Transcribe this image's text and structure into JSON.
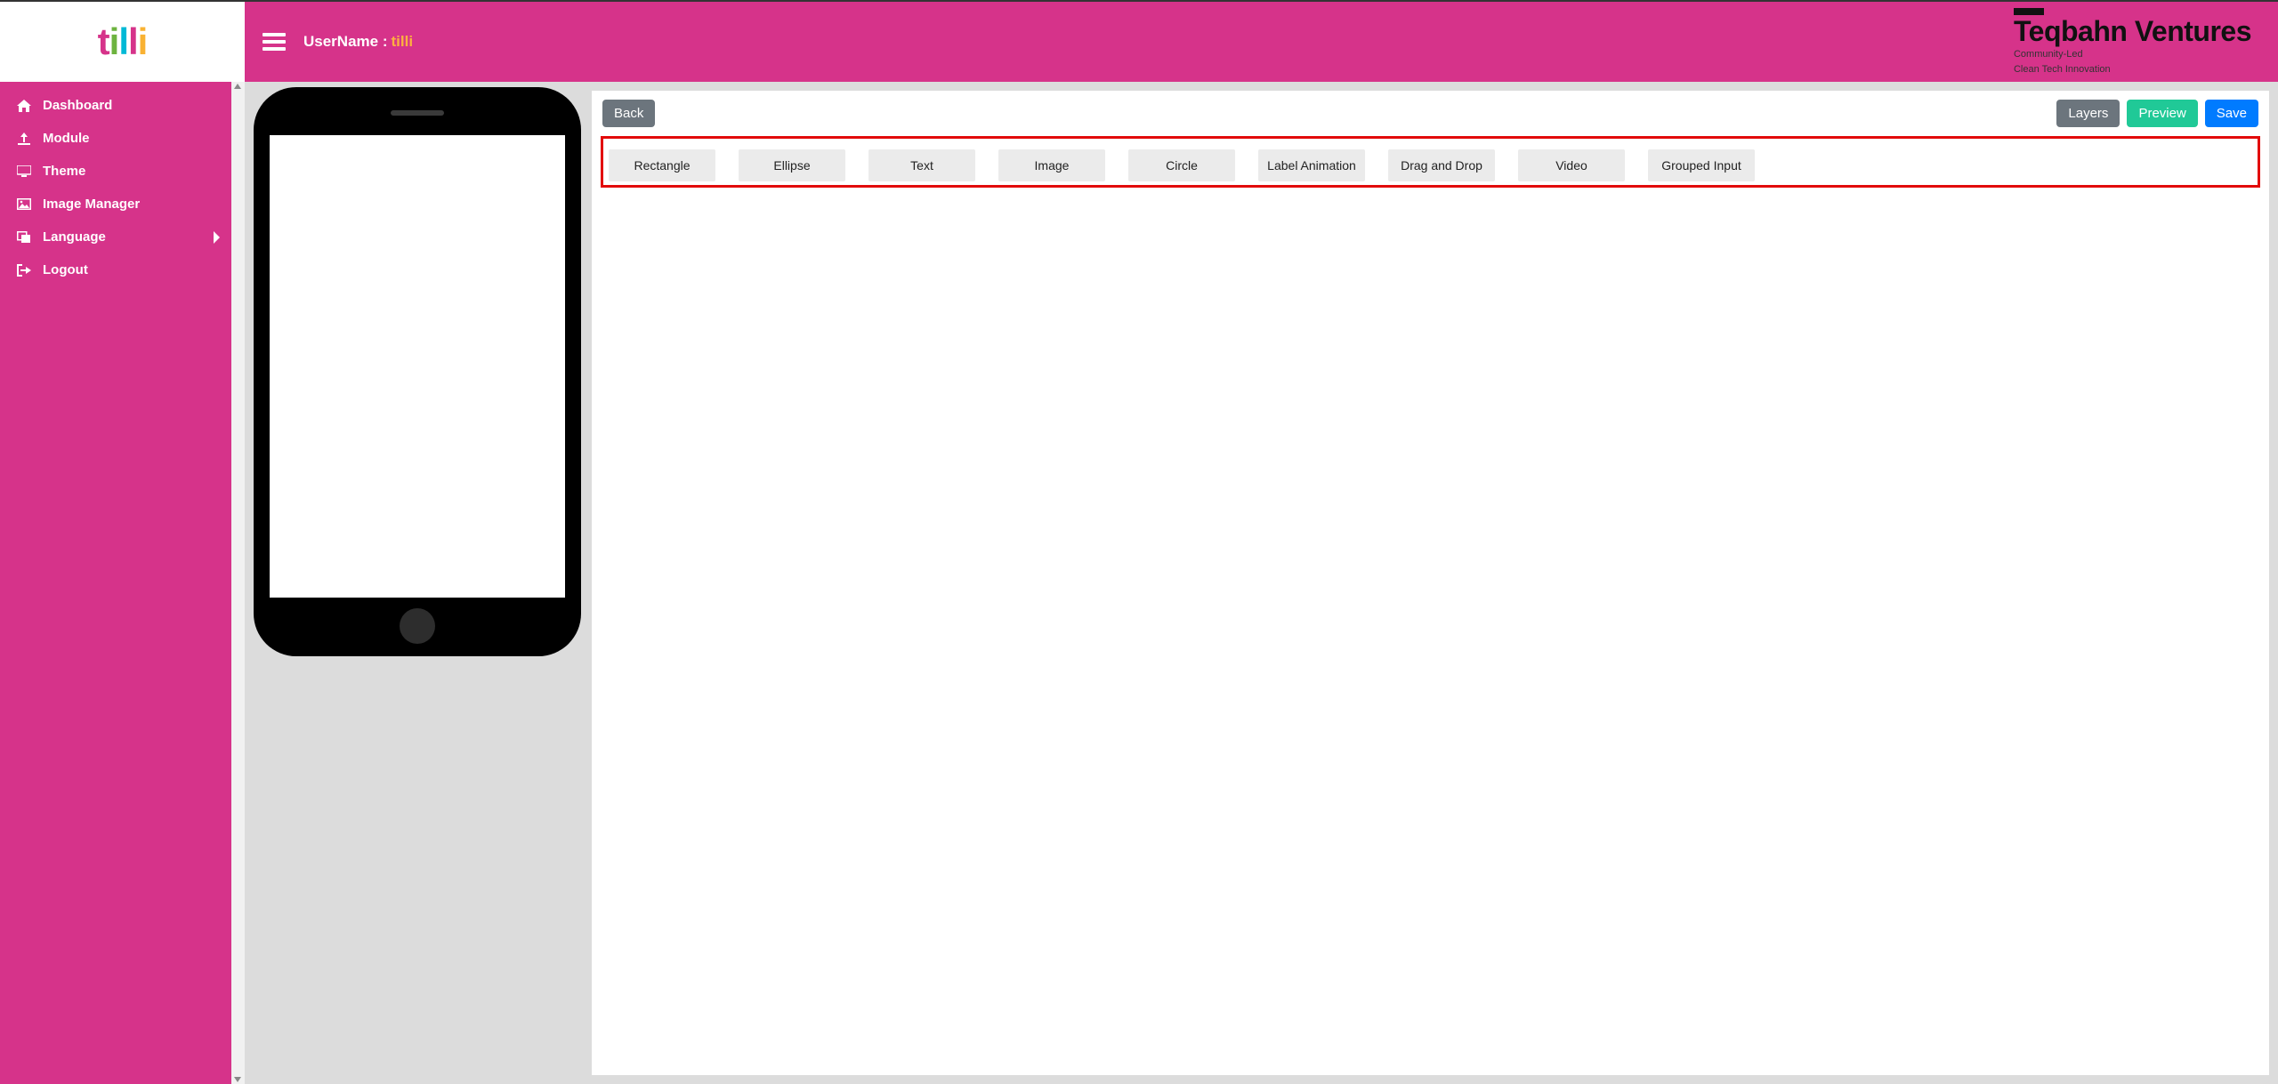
{
  "logo": {
    "letters": [
      "t",
      "i",
      "l",
      "l",
      "i"
    ]
  },
  "header": {
    "username_label": "UserName :",
    "username_value": "tilli",
    "brand_name": "Teqbahn Ventures",
    "brand_tag_line1": "Community-Led",
    "brand_tag_line2": "Clean Tech Innovation"
  },
  "sidebar": {
    "items": [
      {
        "label": "Dashboard",
        "icon": "home-icon"
      },
      {
        "label": "Module",
        "icon": "upload-icon"
      },
      {
        "label": "Theme",
        "icon": "display-icon"
      },
      {
        "label": "Image Manager",
        "icon": "image-icon"
      },
      {
        "label": "Language",
        "icon": "language-icon",
        "has_children": true
      },
      {
        "label": "Logout",
        "icon": "logout-icon"
      }
    ]
  },
  "editor": {
    "back_label": "Back",
    "layers_label": "Layers",
    "preview_label": "Preview",
    "save_label": "Save",
    "tools": [
      "Rectangle",
      "Ellipse",
      "Text",
      "Image",
      "Circle",
      "Label Animation",
      "Drag and Drop",
      "Video",
      "Grouped Input"
    ]
  }
}
